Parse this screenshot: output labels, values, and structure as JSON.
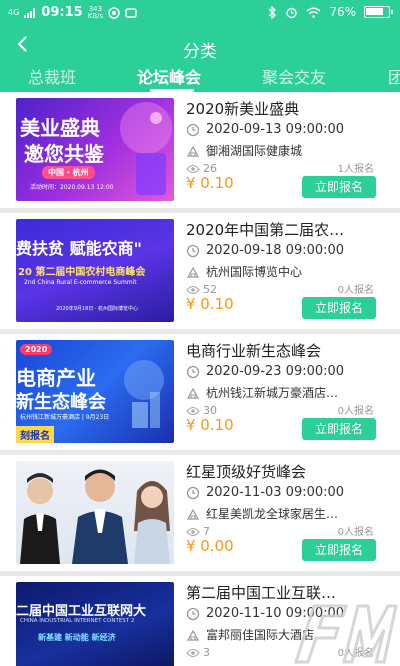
{
  "status_bar": {
    "signal": "4G",
    "time": "09:15",
    "speed_value": "343",
    "speed_unit": "KB/s",
    "battery": "76%"
  },
  "nav": {
    "title": "分类"
  },
  "tabs": [
    {
      "label": "总裁班"
    },
    {
      "label": "论坛峰会",
      "active": true
    },
    {
      "label": "聚会交友"
    },
    {
      "label": "团"
    }
  ],
  "colors": {
    "brand": "#2bcf97",
    "price": "#f39a1a"
  },
  "icons": {
    "back": "chevron-left-icon",
    "clock": "clock-icon",
    "location": "venue-icon",
    "views": "eye-icon"
  },
  "events": [
    {
      "title": "2020新美业盛典",
      "time": "2020-09-13 09:00:00",
      "location": "御湘湖国际健康城",
      "views": "26",
      "signups": "1人报名",
      "price": "¥ 0.10",
      "button": "立即报名",
      "poster": {
        "line1": "美业盛典",
        "line2": "邀您共鉴",
        "tag": "中国 · 杭州",
        "sub": "活动时间：2020.09.13 12:00"
      }
    },
    {
      "title": "2020年中国第二届农…",
      "time": "2020-09-18 09:00:00",
      "location": "杭州国际博览中心",
      "views": "52",
      "signups": "0人报名",
      "price": "¥ 0.10",
      "button": "立即报名",
      "poster": {
        "line1": "费扶贫  赋能农商\"",
        "line2": "20 第二届中国农村电商峰会",
        "line3": "2nd China Rural E-commerce Summit",
        "sub": "2020年9月18日 · 杭州国际博览中心"
      }
    },
    {
      "title": "电商行业新生态峰会",
      "time": "2020-09-23 09:00:00",
      "location": "杭州钱江新城万豪酒店…",
      "views": "30",
      "signups": "0人报名",
      "price": "¥ 0.10",
      "button": "立即报名",
      "poster": {
        "badge": "2020",
        "line1": "电商产业",
        "line2": "新生态峰会",
        "sub": "杭州钱江新城万豪酒店 | 9月23日",
        "cta": "刻报名"
      }
    },
    {
      "title": "红星顶级好货峰会",
      "time": "2020-11-03 09:00:00",
      "location": "红星美凯龙全球家居生…",
      "views": "7",
      "signups": "0人报名",
      "price": "¥ 0.00",
      "button": "立即报名"
    },
    {
      "title": "第二届中国工业互联…",
      "time": "2020-11-10 09:00:00",
      "location": "富邦丽佳国际大酒店",
      "views": "3",
      "signups": "0人报名",
      "price": "",
      "button": "",
      "poster": {
        "line1": "二届中国工业互联网大",
        "line2": "CHINA INDUSTRIAL INTERNET CONTEST 2",
        "line3": "新基建  新动能  新经济"
      }
    }
  ]
}
